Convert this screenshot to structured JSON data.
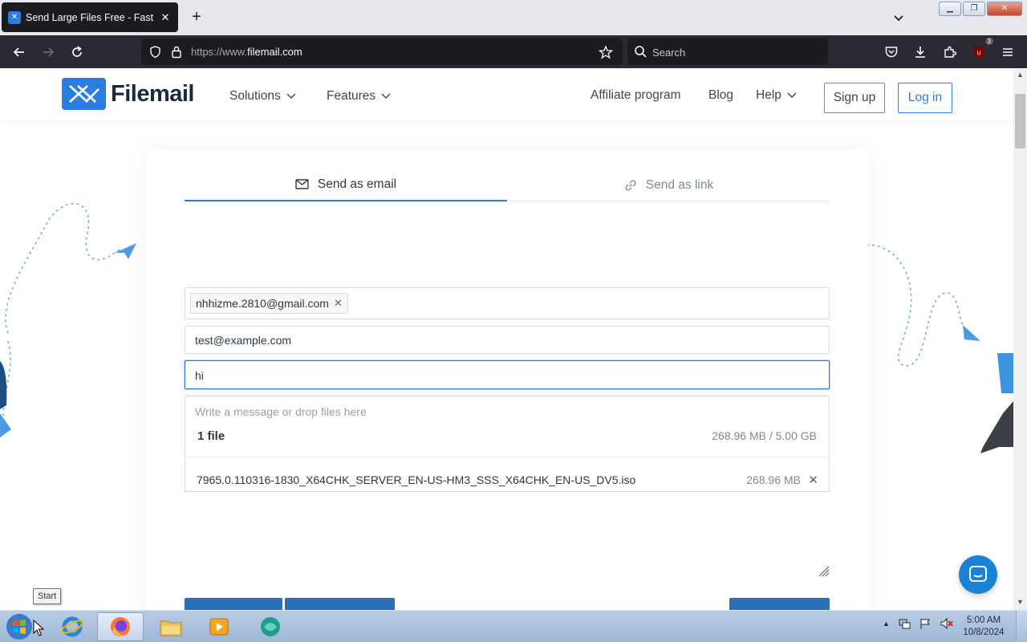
{
  "browser": {
    "tab": {
      "title": "Send Large Files Free - Fast Secure",
      "favicon_text": "✕"
    },
    "url_prefix": "https://www.",
    "url_domain": "filemail.com",
    "search_placeholder": "Search",
    "extension_badge": "3"
  },
  "site": {
    "brand": "Filemail",
    "nav": {
      "solutions": "Solutions",
      "features": "Features",
      "affiliate": "Affiliate program",
      "blog": "Blog",
      "help": "Help"
    },
    "signup": "Sign up",
    "login": "Log in"
  },
  "form": {
    "tabs": {
      "email": "Send as email",
      "link": "Send as link"
    },
    "to_chip": "nhhizme.2810@gmail.com",
    "from_value": "test@example.com",
    "subject_value": "hi",
    "message_placeholder": "Write a message or drop files here",
    "files_count": "1 file",
    "files_total": "268.96 MB / 5.00 GB",
    "file": {
      "name": "7965.0.110316-1830_X64CHK_SERVER_EN-US-HM3_SSS_X64CHK_EN-US_DV5.iso",
      "size": "268.96 MB"
    }
  },
  "taskbar": {
    "tooltip": "Start",
    "time": "5:00 AM",
    "date": "10/8/2024"
  },
  "colors": {
    "brand": "#2a7de1",
    "chrome_dark": "#2b2a33",
    "text": "#2d3744"
  }
}
